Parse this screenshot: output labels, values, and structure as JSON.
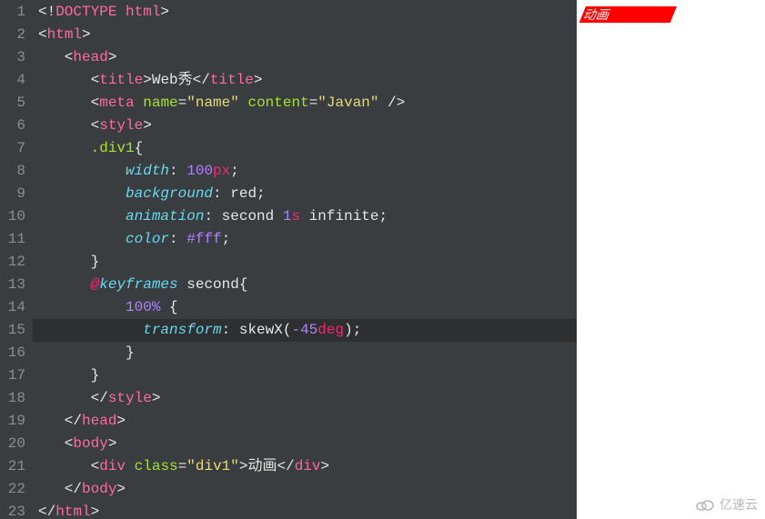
{
  "editor": {
    "lines": [
      {
        "n": 1,
        "tokens": [
          [
            "punc",
            "<!"
          ],
          [
            "tag",
            "DOCTYPE html"
          ],
          [
            "punc",
            ">"
          ]
        ]
      },
      {
        "n": 2,
        "tokens": [
          [
            "punc",
            "<"
          ],
          [
            "tag",
            "html"
          ],
          [
            "punc",
            ">"
          ]
        ]
      },
      {
        "n": 3,
        "tokens": [
          [
            "punc",
            "   <"
          ],
          [
            "tag",
            "head"
          ],
          [
            "punc",
            ">"
          ]
        ]
      },
      {
        "n": 4,
        "tokens": [
          [
            "punc",
            "      <"
          ],
          [
            "tag",
            "title"
          ],
          [
            "punc",
            ">"
          ],
          [
            "punc",
            "Web秀"
          ],
          [
            "punc",
            "</"
          ],
          [
            "tag",
            "title"
          ],
          [
            "punc",
            ">"
          ]
        ]
      },
      {
        "n": 5,
        "tokens": [
          [
            "punc",
            "      <"
          ],
          [
            "tag",
            "meta"
          ],
          [
            "punc",
            " "
          ],
          [
            "attr",
            "name"
          ],
          [
            "punc",
            "="
          ],
          [
            "str",
            "\"name\""
          ],
          [
            "punc",
            " "
          ],
          [
            "attr",
            "content"
          ],
          [
            "punc",
            "="
          ],
          [
            "str",
            "\"Javan\""
          ],
          [
            "punc",
            " />"
          ]
        ]
      },
      {
        "n": 6,
        "tokens": [
          [
            "punc",
            "      <"
          ],
          [
            "tag",
            "style"
          ],
          [
            "punc",
            ">"
          ]
        ]
      },
      {
        "n": 7,
        "tokens": [
          [
            "punc",
            "      "
          ],
          [
            "cls",
            ".div1"
          ],
          [
            "punc",
            "{"
          ]
        ]
      },
      {
        "n": 8,
        "tokens": [
          [
            "punc",
            "          "
          ],
          [
            "prop",
            "width"
          ],
          [
            "punc",
            ": "
          ],
          [
            "num",
            "100"
          ],
          [
            "unit",
            "px"
          ],
          [
            "punc",
            ";"
          ]
        ]
      },
      {
        "n": 9,
        "tokens": [
          [
            "punc",
            "          "
          ],
          [
            "prop",
            "background"
          ],
          [
            "punc",
            ": "
          ],
          [
            "punc",
            "red;"
          ]
        ]
      },
      {
        "n": 10,
        "tokens": [
          [
            "punc",
            "          "
          ],
          [
            "prop",
            "animation"
          ],
          [
            "punc",
            ": "
          ],
          [
            "punc",
            "second "
          ],
          [
            "num",
            "1"
          ],
          [
            "unit",
            "s"
          ],
          [
            "punc",
            " infinite;"
          ]
        ]
      },
      {
        "n": 11,
        "tokens": [
          [
            "punc",
            "          "
          ],
          [
            "prop",
            "color"
          ],
          [
            "punc",
            ": "
          ],
          [
            "num",
            "#fff"
          ],
          [
            "punc",
            ";"
          ]
        ]
      },
      {
        "n": 12,
        "tokens": [
          [
            "punc",
            "      }"
          ]
        ]
      },
      {
        "n": 13,
        "tokens": [
          [
            "punc",
            "      "
          ],
          [
            "at",
            "@"
          ],
          [
            "id",
            "keyframes"
          ],
          [
            "punc",
            " second{"
          ]
        ]
      },
      {
        "n": 14,
        "tokens": [
          [
            "punc",
            "          "
          ],
          [
            "num",
            "100%"
          ],
          [
            "punc",
            " {"
          ]
        ]
      },
      {
        "n": 15,
        "tokens": [
          [
            "punc",
            "            "
          ],
          [
            "prop",
            "transform"
          ],
          [
            "punc",
            ": "
          ],
          [
            "fn",
            "skewX"
          ],
          [
            "punc",
            "("
          ],
          [
            "num",
            "-45"
          ],
          [
            "unit",
            "deg"
          ],
          [
            "punc",
            ");"
          ]
        ]
      },
      {
        "n": 16,
        "tokens": [
          [
            "punc",
            "          }"
          ]
        ]
      },
      {
        "n": 17,
        "tokens": [
          [
            "punc",
            "      }"
          ]
        ]
      },
      {
        "n": 18,
        "tokens": [
          [
            "punc",
            "      </"
          ],
          [
            "tag",
            "style"
          ],
          [
            "punc",
            ">"
          ]
        ]
      },
      {
        "n": 19,
        "tokens": [
          [
            "punc",
            "   </"
          ],
          [
            "tag",
            "head"
          ],
          [
            "punc",
            ">"
          ]
        ]
      },
      {
        "n": 20,
        "tokens": [
          [
            "punc",
            "   <"
          ],
          [
            "tag",
            "body"
          ],
          [
            "punc",
            ">"
          ]
        ]
      },
      {
        "n": 21,
        "tokens": [
          [
            "punc",
            "      <"
          ],
          [
            "tag",
            "div"
          ],
          [
            "punc",
            " "
          ],
          [
            "attr",
            "class"
          ],
          [
            "punc",
            "="
          ],
          [
            "str",
            "\"div1\""
          ],
          [
            "punc",
            ">"
          ],
          [
            "punc",
            "动画"
          ],
          [
            "punc",
            "</"
          ],
          [
            "tag",
            "div"
          ],
          [
            "punc",
            ">"
          ]
        ]
      },
      {
        "n": 22,
        "tokens": [
          [
            "punc",
            "   </"
          ],
          [
            "tag",
            "body"
          ],
          [
            "punc",
            ">"
          ]
        ]
      },
      {
        "n": 23,
        "tokens": [
          [
            "punc",
            "</"
          ],
          [
            "tag",
            "html"
          ],
          [
            "punc",
            ">"
          ]
        ]
      }
    ],
    "active_line": 15
  },
  "preview": {
    "box_text": "动画"
  },
  "watermark": {
    "text": "亿速云"
  }
}
